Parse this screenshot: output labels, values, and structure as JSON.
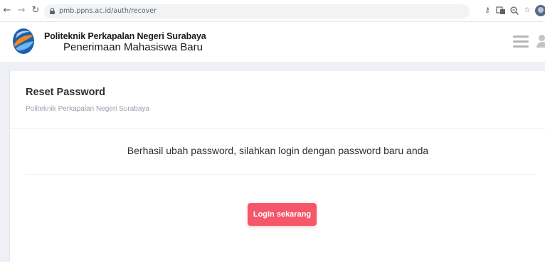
{
  "browser": {
    "url": "pmb.ppns.ac.id/auth/recover",
    "icons": {
      "back": "arrow-left-icon",
      "forward": "arrow-right-icon",
      "reload": "reload-icon",
      "lock": "lock-icon",
      "key": "key-icon",
      "translate": "translate-icon",
      "zoom": "zoom-icon",
      "bookmark": "star-icon",
      "profile": "profile-icon"
    }
  },
  "header": {
    "institution_name": "Politeknik Perkapalan Negeri Surabaya",
    "subtitle": "Penerimaan Mahasiswa Baru",
    "icons": {
      "logo": "ppns-logo-icon",
      "menu": "hamburger-icon",
      "user": "user-icon"
    }
  },
  "card": {
    "title": "Reset Password",
    "subtitle": "Politeknik Perkapalan Negeri Surabaya",
    "message": "Berhasil ubah password, silahkan login dengan password baru anda",
    "button_label": "Login sekarang"
  },
  "colors": {
    "accent": "#f4566a",
    "page_background": "#eef0f6",
    "logo_blue": "#1e5fb4",
    "logo_orange": "#f08a1c"
  }
}
